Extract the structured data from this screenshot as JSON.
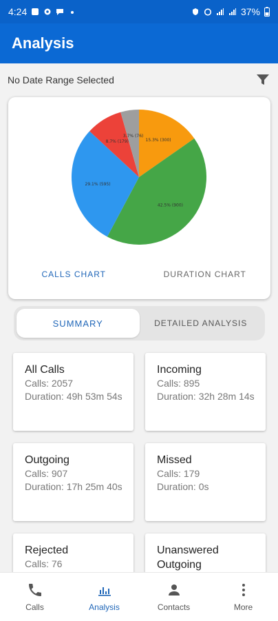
{
  "status_bar": {
    "time": "4:24",
    "battery": "37%"
  },
  "app_bar": {
    "title": "Analysis"
  },
  "filter": {
    "label": "No Date Range Selected",
    "icon": "filter-icon"
  },
  "chart_data": {
    "type": "pie",
    "slices": [
      {
        "label": "15.3% (300)",
        "value": 15.3,
        "color": "#f89a0e"
      },
      {
        "label": "42.5% (900)",
        "value": 42.5,
        "color": "#45a647"
      },
      {
        "label": "29.1% (595)",
        "value": 29.1,
        "color": "#2e97ef"
      },
      {
        "label": "8.7% (179)",
        "value": 8.7,
        "color": "#ec4239"
      },
      {
        "label": "3.7% (76)",
        "value": 4.4,
        "color": "#9e9e9e"
      }
    ]
  },
  "chart_tabs": {
    "calls": "CALLS CHART",
    "duration": "DURATION CHART"
  },
  "segments": {
    "summary": "SUMMARY",
    "detailed": "DETAILED ANALYSIS"
  },
  "cards": [
    {
      "title": "All Calls",
      "calls": "Calls: 2057",
      "duration": "Duration: 49h 53m 54s"
    },
    {
      "title": "Incoming",
      "calls": "Calls: 895",
      "duration": "Duration: 32h 28m 14s"
    },
    {
      "title": "Outgoing",
      "calls": "Calls: 907",
      "duration": "Duration: 17h 25m 40s"
    },
    {
      "title": "Missed",
      "calls": "Calls: 179",
      "duration": "Duration: 0s"
    },
    {
      "title": "Rejected",
      "calls": "Calls: 76",
      "duration": ""
    },
    {
      "title": "Unanswered Outgoing",
      "calls": "",
      "duration": ""
    }
  ],
  "bottom_nav": {
    "calls": "Calls",
    "analysis": "Analysis",
    "contacts": "Contacts",
    "more": "More"
  },
  "colors": {
    "primary": "#0b69d4",
    "accent": "#1f66b8"
  }
}
